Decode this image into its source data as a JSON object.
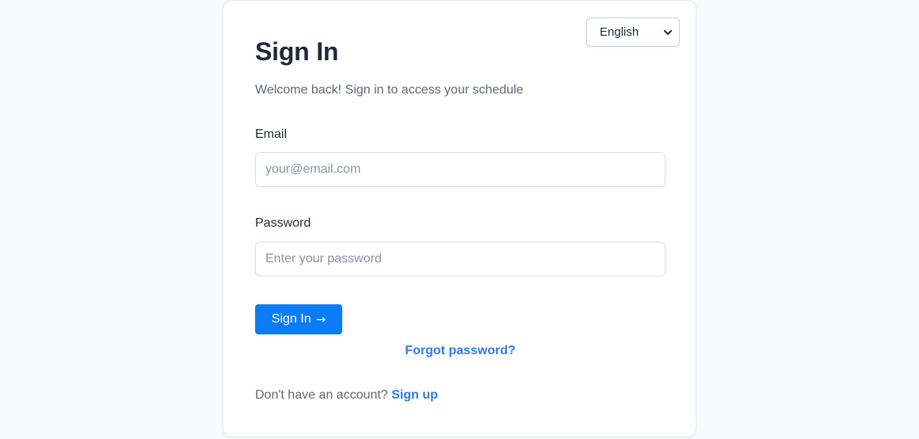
{
  "language_selector": {
    "selected": "English",
    "icon": "chevron-down-icon"
  },
  "header": {
    "title": "Sign In",
    "subtitle": "Welcome back! Sign in to access your schedule"
  },
  "form": {
    "email": {
      "label": "Email",
      "value": "",
      "placeholder": "your@email.com"
    },
    "password": {
      "label": "Password",
      "value": "",
      "placeholder": "Enter your password"
    },
    "submit": {
      "label": "Sign In",
      "arrow": "→"
    },
    "forgot_password": "Forgot password?"
  },
  "footer": {
    "prompt": "Don't have an account?",
    "signup_label": "Sign up"
  },
  "colors": {
    "primary_button": "#0a7cf5",
    "link": "#2f7ae6",
    "heading": "#1e293b",
    "muted_text": "#5b6678",
    "page_background": "#f8fafc"
  }
}
